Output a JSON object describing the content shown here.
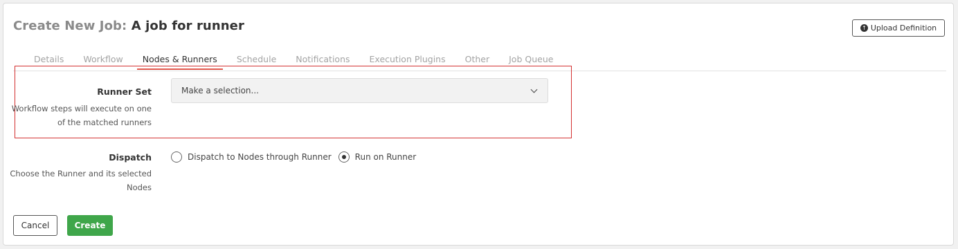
{
  "header": {
    "title_prefix": "Create New Job:",
    "job_name": "A job for runner",
    "upload_button_label": "Upload Definition"
  },
  "tabs": [
    {
      "label": "Details"
    },
    {
      "label": "Workflow"
    },
    {
      "label": "Nodes & Runners",
      "active": true
    },
    {
      "label": "Schedule"
    },
    {
      "label": "Notifications"
    },
    {
      "label": "Execution Plugins"
    },
    {
      "label": "Other"
    },
    {
      "label": "Job Queue"
    }
  ],
  "runner_set": {
    "label": "Runner Set",
    "help": "Workflow steps will execute on one of the matched runners",
    "select_value": "Make a selection..."
  },
  "dispatch": {
    "label": "Dispatch",
    "help": "Choose the Runner and its selected Nodes",
    "options": [
      {
        "label": "Dispatch to Nodes through Runner",
        "selected": false
      },
      {
        "label": "Run on Runner",
        "selected": true
      }
    ]
  },
  "footer": {
    "cancel_label": "Cancel",
    "create_label": "Create"
  },
  "colors": {
    "active_tab_underline": "#e2574c",
    "highlight_border": "#d32f2f",
    "create_button": "#3fa64a"
  }
}
